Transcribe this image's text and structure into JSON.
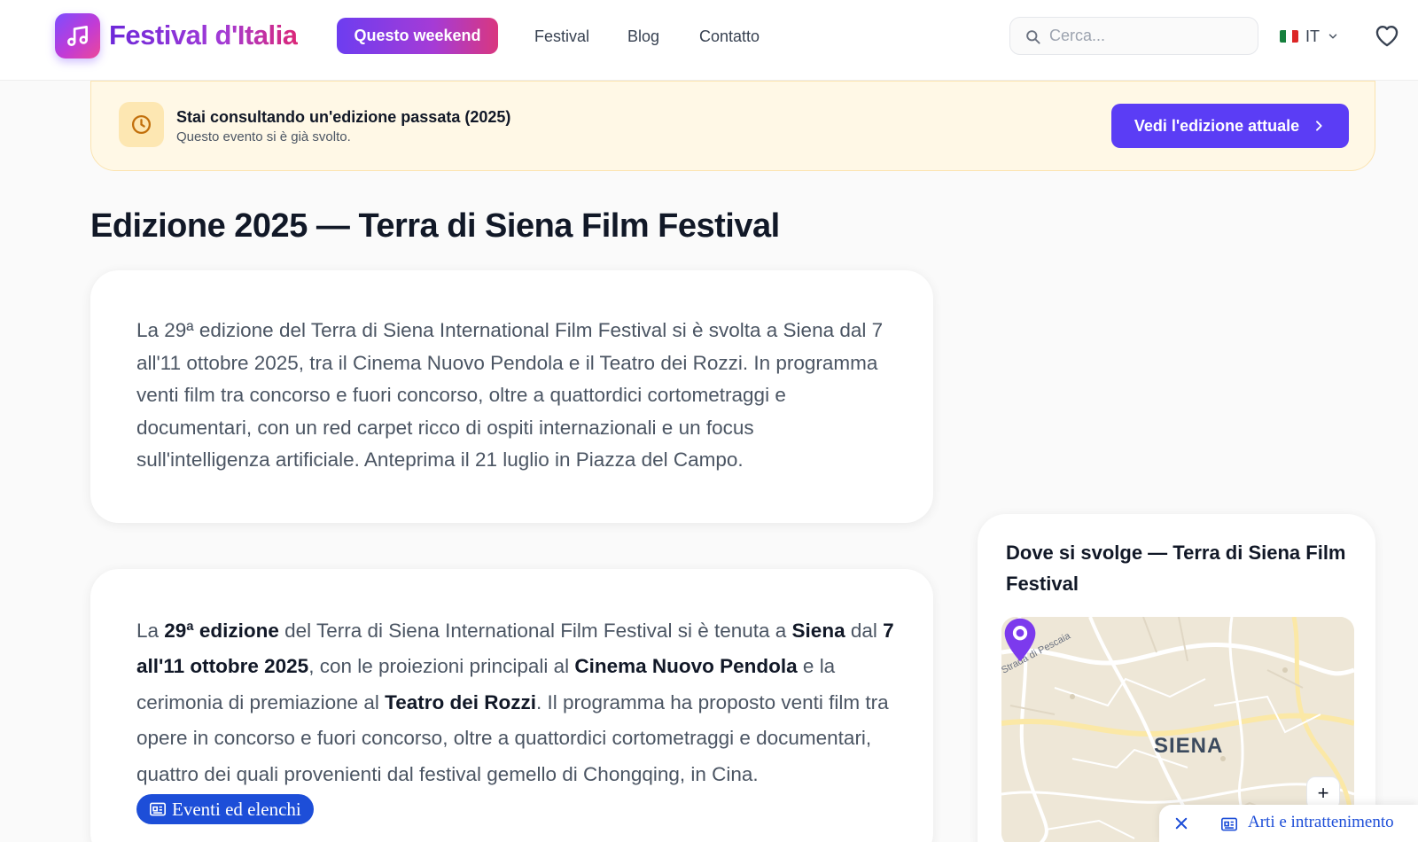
{
  "header": {
    "brand": "Festival d'Italia",
    "nav": {
      "active": "Questo weekend",
      "festival": "Festival",
      "blog": "Blog",
      "contact": "Contatto"
    },
    "search_placeholder": "Cerca...",
    "language": "IT"
  },
  "banner": {
    "title": "Stai consultando un'edizione passata (2025)",
    "subtitle": "Questo evento si è già svolto.",
    "button": "Vedi l'edizione attuale"
  },
  "page_title": "Edizione 2025 — Terra di Siena Film Festival",
  "summary": "La 29ª edizione del Terra di Siena International Film Festival si è svolta a Siena dal 7 all'11 ottobre 2025, tra il Cinema Nuovo Pendola e il Teatro dei Rozzi. In programma venti film tra concorso e fuori concorso, oltre a quattordici cortometraggi e documentari, con un red carpet ricco di ospiti internazionali e un focus sull'intelligenza artificiale. Anteprima il 21 luglio in Piazza del Campo.",
  "details": {
    "t1": "La ",
    "b1": "29ª edizione",
    "t2": " del Terra di Siena International Film Festival si è tenuta a ",
    "b2": "Siena",
    "t3": " dal ",
    "b3": "7 all'11 ottobre 2025",
    "t4": ", con le proiezioni principali al ",
    "b4": "Cinema Nuovo Pendola",
    "t5": " e la cerimonia di premiazione al ",
    "b5": "Teatro dei Rozzi",
    "t6": ". Il programma ha proposto venti film tra opere in concorso e fuori concorso, oltre a quattordici cortometraggi e documentari, quattro dei quali provenienti dal festival gemello di Chongqing, in Cina.",
    "tag": "Eventi ed elenchi"
  },
  "location": {
    "title": "Dove si svolge — Terra di Siena Film Festival",
    "map_city": "SIENA",
    "map_street": "Strada di Pescaia",
    "zoom_in": "+"
  },
  "floating_chip": {
    "label": "Arti e intrattenimento"
  },
  "colors": {
    "accent": "#5b3df5",
    "banner_bg": "#fff8e6",
    "tag_blue": "#1d4ed8",
    "pin": "#7c3aed"
  },
  "icons": [
    "music-note-icon",
    "search-icon",
    "italy-flag-icon",
    "chevron-down-icon",
    "heart-icon",
    "clock-icon",
    "chevron-right-icon",
    "newspaper-icon",
    "map-pin-icon",
    "close-icon"
  ]
}
